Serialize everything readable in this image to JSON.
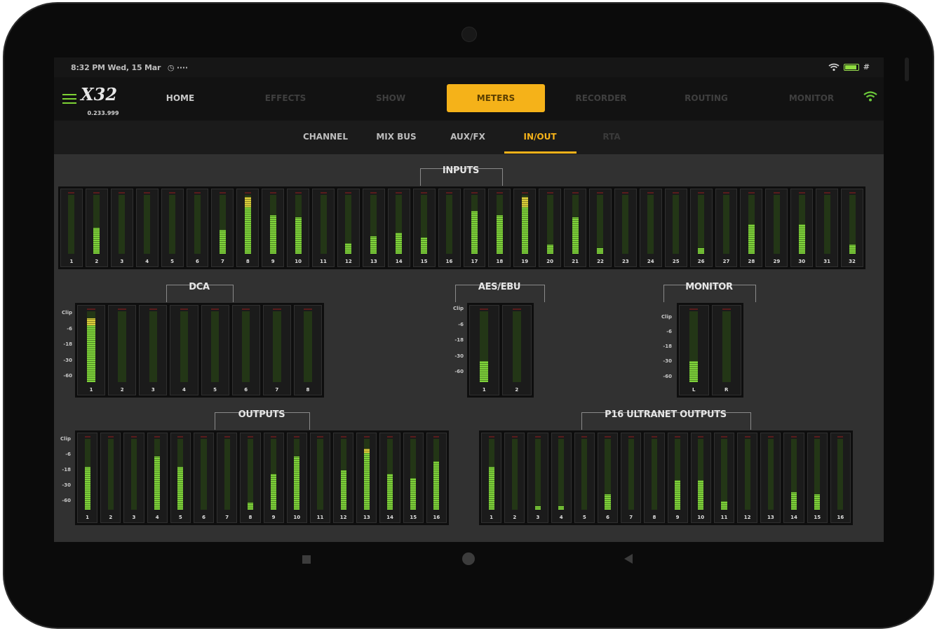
{
  "status": {
    "time_text": "8:32 PM  Wed, 15 Mar",
    "extra_text": "◷ ····",
    "right_text": "#"
  },
  "app": {
    "logo": "X32",
    "device": "0.233.999"
  },
  "nav": {
    "tabs": [
      "HOME",
      "EFFECTS",
      "SHOW",
      "METERS",
      "RECORDER",
      "ROUTING",
      "MONITOR"
    ],
    "active": "METERS"
  },
  "subnav": {
    "tabs": [
      "CHANNEL",
      "MIX BUS",
      "AUX/FX",
      "IN/OUT",
      "RTA"
    ],
    "active": "IN/OUT"
  },
  "colors": {
    "accent": "#f5b219",
    "meter_green": "#7ed23a",
    "meter_yellow": "#d8cc3a"
  },
  "scale_labels": [
    "Clip",
    "-6",
    "-18",
    "-30",
    "-60"
  ],
  "sections": {
    "inputs": {
      "title": "INPUTS",
      "labels": [
        "1",
        "2",
        "3",
        "4",
        "5",
        "6",
        "7",
        "8",
        "9",
        "10",
        "11",
        "12",
        "13",
        "14",
        "15",
        "16",
        "17",
        "18",
        "19",
        "20",
        "21",
        "22",
        "23",
        "24",
        "25",
        "26",
        "27",
        "28",
        "29",
        "30",
        "31",
        "32"
      ],
      "levels": [
        0,
        0.44,
        0,
        0,
        0,
        0,
        0.4,
        0.97,
        0.66,
        0.62,
        0,
        0.18,
        0.3,
        0.36,
        0.27,
        0,
        0.73,
        0.66,
        0.97,
        0.15,
        0.62,
        0.1,
        0,
        0,
        0,
        0.1,
        0,
        0.5,
        0,
        0.5,
        0,
        0.15
      ]
    },
    "dca": {
      "title": "DCA",
      "labels": [
        "1",
        "2",
        "3",
        "4",
        "5",
        "6",
        "7",
        "8"
      ],
      "levels": [
        0.9,
        0,
        0,
        0,
        0,
        0,
        0,
        0
      ]
    },
    "aes": {
      "title": "AES/EBU",
      "labels": [
        "1",
        "2"
      ],
      "levels": [
        0.3,
        0
      ]
    },
    "monitor": {
      "title": "MONITOR",
      "labels": [
        "L",
        "R"
      ],
      "levels": [
        0.3,
        0
      ]
    },
    "outputs": {
      "title": "OUTPUTS",
      "labels": [
        "1",
        "2",
        "3",
        "4",
        "5",
        "6",
        "7",
        "8",
        "9",
        "10",
        "11",
        "12",
        "13",
        "14",
        "15",
        "16"
      ],
      "levels": [
        0.6,
        0,
        0,
        0.75,
        0.6,
        0,
        0,
        0.1,
        0.5,
        0.75,
        0,
        0.55,
        0.86,
        0.5,
        0.45,
        0.68
      ]
    },
    "p16": {
      "title": "P16 ULTRANET OUTPUTS",
      "labels": [
        "1",
        "2",
        "3",
        "4",
        "5",
        "6",
        "7",
        "8",
        "9",
        "10",
        "11",
        "12",
        "13",
        "14",
        "15",
        "16"
      ],
      "levels": [
        0.6,
        0,
        0.05,
        0.05,
        0,
        0.22,
        0,
        0,
        0.42,
        0.42,
        0.12,
        0,
        0,
        0.25,
        0.22,
        0
      ]
    }
  }
}
